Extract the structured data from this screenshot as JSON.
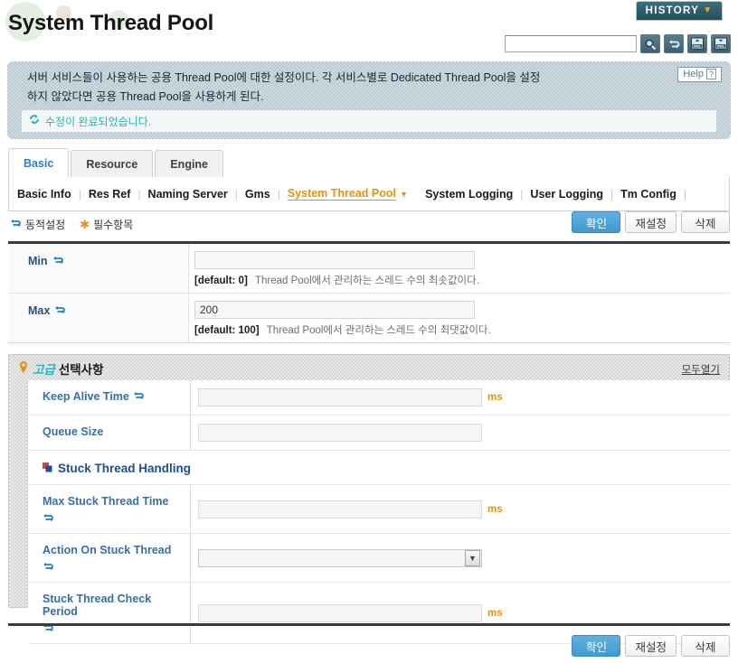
{
  "header": {
    "title": "System Thread Pool",
    "history_label": "HISTORY",
    "history_caret": "▼",
    "search_value": "",
    "search_placeholder": "",
    "toolbar_buttons": [
      {
        "name": "search-icon",
        "label": ""
      },
      {
        "name": "refresh-icon",
        "label": ""
      },
      {
        "name": "xml-import-icon",
        "label": "XML"
      },
      {
        "name": "xml-export-icon",
        "label": "XML"
      }
    ]
  },
  "description": {
    "line1": "서버 서비스들이 사용하는 공용 Thread Pool에 대한 설정이다. 각 서비스별로 Dedicated Thread Pool을 설정",
    "line2": "하지 않았다면 공용 Thread Pool을 사용하게 된다.",
    "help_label": "Help",
    "help_mark": "?",
    "status_message": "수정이 완료되었습니다."
  },
  "tabs": [
    {
      "label": "Basic",
      "active": true
    },
    {
      "label": "Resource",
      "active": false
    },
    {
      "label": "Engine",
      "active": false
    }
  ],
  "subnav": [
    {
      "label": "Basic Info",
      "active": false
    },
    {
      "label": "Res Ref",
      "active": false
    },
    {
      "label": "Naming Server",
      "active": false
    },
    {
      "label": "Gms",
      "active": false
    },
    {
      "label": "System Thread Pool",
      "active": true
    },
    {
      "label": "System Logging",
      "active": false
    },
    {
      "label": "User Logging",
      "active": false
    },
    {
      "label": "Tm Config",
      "active": false
    }
  ],
  "legend": {
    "dynamic_label": "동적설정",
    "required_label": "필수항목",
    "required_mark": "✱"
  },
  "buttons": {
    "confirm": "확인",
    "reset": "재설정",
    "delete": "삭제"
  },
  "fields": [
    {
      "label": "Min",
      "dynamic": true,
      "value": "",
      "default_label": "[default: 0]",
      "hint": "Thread Pool에서 관리하는 스레드 수의 최솟값이다."
    },
    {
      "label": "Max",
      "dynamic": true,
      "value": "200",
      "default_label": "[default: 100]",
      "hint": "Thread Pool에서 관리하는 스레드 수의 최댓값이다."
    }
  ],
  "advanced": {
    "title_accent": "고급",
    "title_rest": "선택사항",
    "expand_all": "모두열기",
    "fields": [
      {
        "label": "Keep Alive Time",
        "dynamic": true,
        "value": "",
        "unit": "ms",
        "type": "text"
      },
      {
        "label": "Queue Size",
        "dynamic": false,
        "value": "",
        "unit": "",
        "type": "text"
      }
    ],
    "subsection": {
      "title": "Stuck Thread Handling",
      "fields": [
        {
          "label": "Max Stuck Thread Time",
          "dynamic": true,
          "value": "",
          "unit": "ms",
          "type": "text"
        },
        {
          "label": "Action On Stuck Thread",
          "dynamic": true,
          "value": "",
          "unit": "",
          "type": "select"
        },
        {
          "label": "Stuck Thread Check Period",
          "dynamic": true,
          "value": "",
          "unit": "ms",
          "type": "text"
        }
      ]
    }
  },
  "colors": {
    "primary_button": "#3f9ad3",
    "accent_orange": "#e8920b",
    "label_blue": "#2b5175",
    "status_teal": "#2fb3ad",
    "history_teal": "#2d5c6b"
  }
}
